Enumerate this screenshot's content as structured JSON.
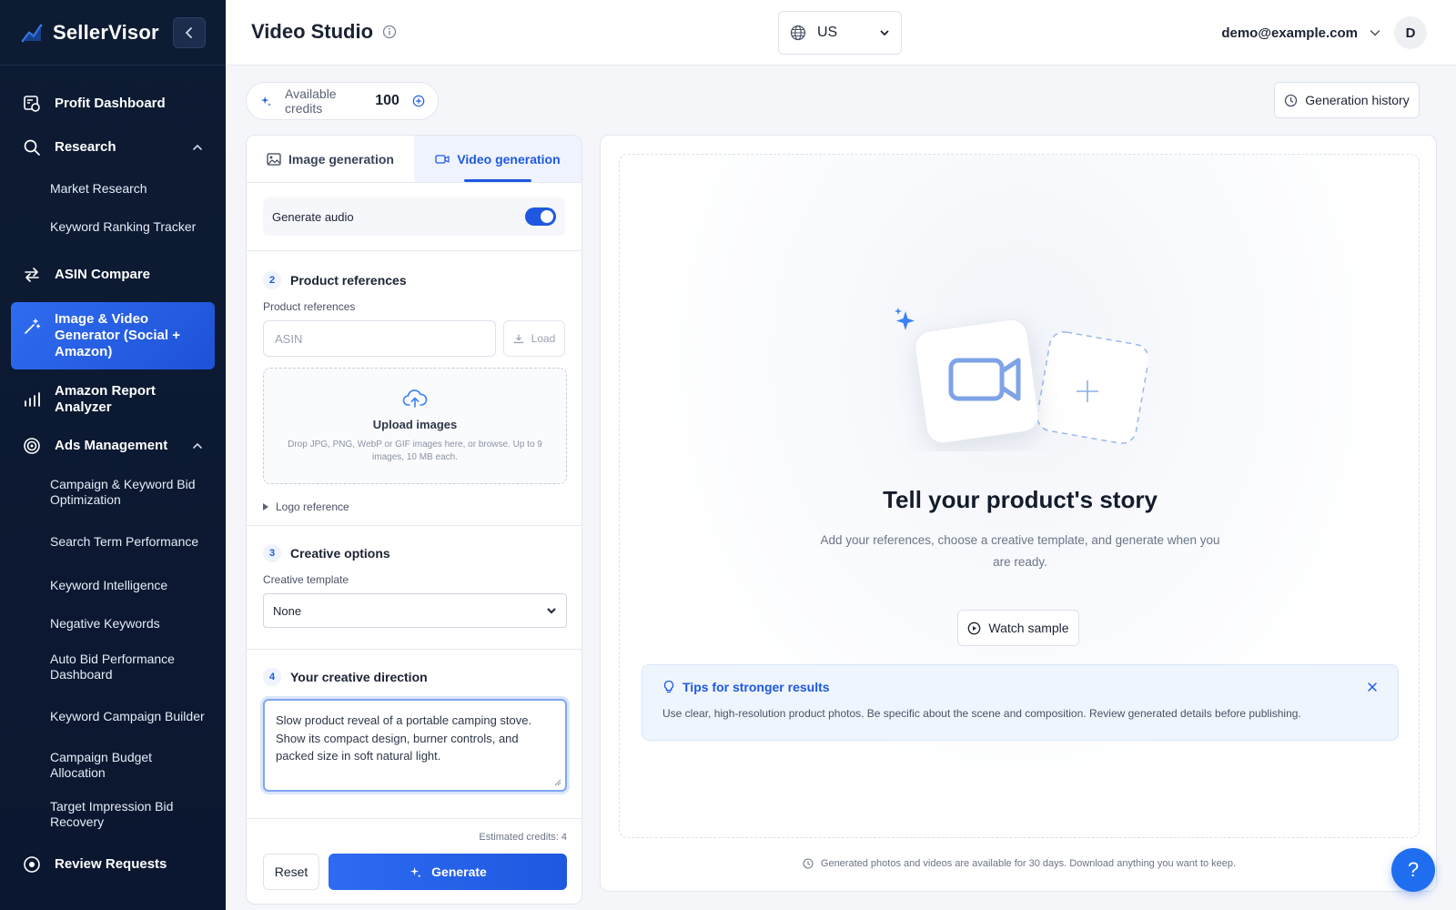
{
  "brand": {
    "name": "SellerVisor"
  },
  "sidebar": {
    "items": [
      {
        "label": "Profit Dashboard"
      },
      {
        "label": "Research"
      },
      {
        "label": "ASIN Compare"
      },
      {
        "label": "Image & Video Generator (Social + Amazon)"
      },
      {
        "label": "Amazon Report Analyzer"
      },
      {
        "label": "Ads Management"
      },
      {
        "label": "Review Requests"
      }
    ],
    "research_sub": [
      "Market Research",
      "Keyword Ranking Tracker"
    ],
    "ads_sub": [
      "Campaign & Keyword Bid Optimization",
      "Search Term Performance",
      "Keyword Intelligence",
      "Negative Keywords",
      "Auto Bid Performance Dashboard",
      "Keyword Campaign Builder",
      "Campaign Budget Allocation",
      "Target Impression Bid Recovery"
    ]
  },
  "header": {
    "title": "Video Studio",
    "region": "US",
    "user_email": "demo@example.com",
    "avatar_initial": "D"
  },
  "credits": {
    "label": "Available credits",
    "value": "100"
  },
  "history_button": "Generation history",
  "tabs": [
    {
      "label": "Image generation"
    },
    {
      "label": "Video generation"
    }
  ],
  "audio": {
    "label": "Generate audio",
    "enabled": true
  },
  "product_refs": {
    "step": "2",
    "title": "Product references",
    "field_label": "Product references",
    "asin_placeholder": "ASIN",
    "load_label": "Load",
    "upload_title": "Upload images",
    "upload_sub": "Drop JPG, PNG, WebP or GIF images here, or browse. Up to 9 images, 10 MB each.",
    "logo_ref": "Logo reference"
  },
  "creative_options": {
    "step": "3",
    "title": "Creative options",
    "template_label": "Creative template",
    "template_value": "None"
  },
  "direction": {
    "step": "4",
    "title": "Your creative direction",
    "text": "Slow product reveal of a portable camping stove. Show its compact design, burner controls, and packed size in soft natural light."
  },
  "footer": {
    "estimated": "Estimated credits: 4",
    "reset": "Reset",
    "generate": "Generate"
  },
  "preview": {
    "title": "Tell your product's story",
    "subtitle": "Add your references, choose a creative template, and generate when you are ready.",
    "sample_button": "Watch sample",
    "tips_title": "Tips for stronger results",
    "tips_body": "Use clear, high-resolution product photos. Be specific about the scene and composition. Review generated details before publishing.",
    "notice": "Generated photos and videos are available for 30 days. Download anything you want to keep."
  },
  "help": "?",
  "colors": {
    "accent": "#1f58e0",
    "sidebar_bg": "#0d1b33"
  }
}
